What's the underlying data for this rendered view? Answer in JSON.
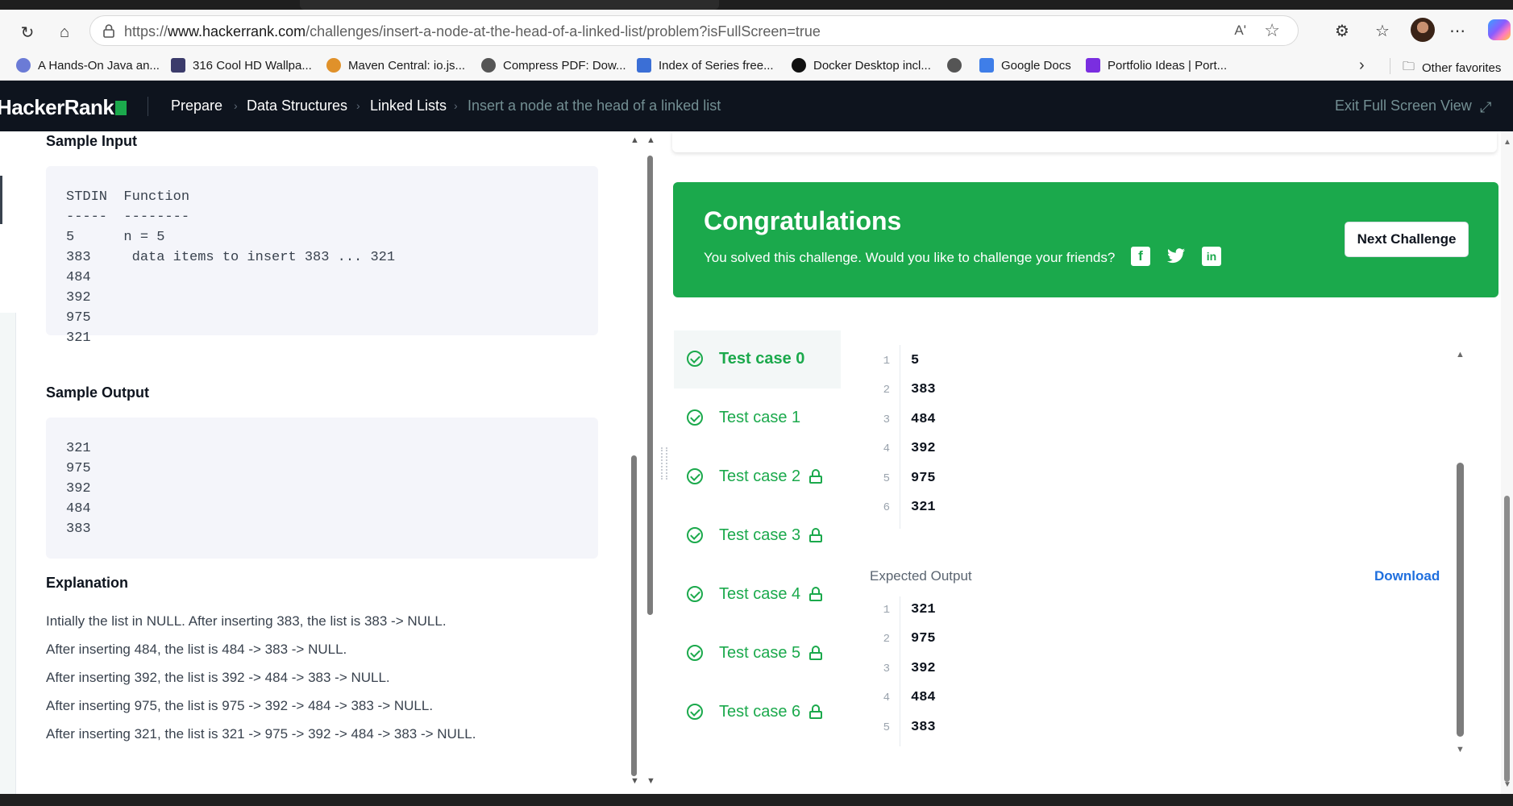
{
  "browser": {
    "url_prefix": "https://",
    "url_domain": "www.hackerrank.com",
    "url_path": "/challenges/insert-a-node-at-the-head-of-a-linked-list/problem?isFullScreen=true",
    "read_aloud_icon": "Aʹ",
    "bookmarks": [
      {
        "label": "A Hands-On Java an...",
        "color": "#6b7bd6"
      },
      {
        "label": "316 Cool HD Wallpa...",
        "color": "#3b3b6b"
      },
      {
        "label": "Maven Central: io.js...",
        "color": "#e0912a"
      },
      {
        "label": "Compress PDF: Dow...",
        "color": "#555555"
      },
      {
        "label": "Index of Series free...",
        "color": "#3b6fd6"
      },
      {
        "label": "Docker Desktop incl...",
        "color": "#111111"
      },
      {
        "label": "",
        "color": "#555555"
      },
      {
        "label": "Google Docs",
        "color": "#3f7ee8"
      },
      {
        "label": "Portfolio Ideas | Port...",
        "color": "#7a2ee0"
      }
    ],
    "other_favorites": "Other favorites"
  },
  "nav": {
    "logo": "HackerRank",
    "crumbs": [
      "Prepare",
      "Data Structures",
      "Linked Lists",
      "Insert a node at the head of a linked list"
    ],
    "exit_full_screen": "Exit Full Screen View"
  },
  "problem": {
    "sample_input_title": "Sample Input",
    "sample_input_lines": [
      "STDIN  Function",
      "-----  --------",
      "5      n = 5",
      "383     data items to insert 383 ... 321",
      "484",
      "392",
      "975",
      "321"
    ],
    "sample_output_title": "Sample Output",
    "sample_output_lines": [
      "321",
      "975",
      "392",
      "484",
      "383"
    ],
    "explanation_title": "Explanation",
    "explanation_lines": [
      "Intially the list in NULL. After inserting 383, the list is 383 -> NULL.",
      "After inserting 484, the list is 484 -> 383 -> NULL.",
      "After inserting 392, the list is 392 -> 484 -> 383 -> NULL.",
      "After inserting 975, the list is 975 -> 392 -> 484 -> 383 -> NULL.",
      "After inserting 321, the list is 321 -> 975 -> 392 -> 484 -> 383 -> NULL."
    ]
  },
  "result": {
    "title": "Congratulations",
    "message": "You solved this challenge. Would you like to challenge your friends?",
    "next_button": "Next Challenge",
    "social": {
      "facebook": "f",
      "twitter": "🐦",
      "linkedin": "in"
    }
  },
  "test_cases": [
    {
      "label": "Test case 0",
      "locked": false,
      "active": true
    },
    {
      "label": "Test case 1",
      "locked": false,
      "active": false
    },
    {
      "label": "Test case 2",
      "locked": true,
      "active": false
    },
    {
      "label": "Test case 3",
      "locked": true,
      "active": false
    },
    {
      "label": "Test case 4",
      "locked": true,
      "active": false
    },
    {
      "label": "Test case 5",
      "locked": true,
      "active": false
    },
    {
      "label": "Test case 6",
      "locked": true,
      "active": false
    }
  ],
  "input_view": {
    "line_numbers": [
      "1",
      "2",
      "3",
      "4",
      "5",
      "6"
    ],
    "lines": [
      "5",
      "383",
      "484",
      "392",
      "975",
      "321"
    ]
  },
  "expected_output": {
    "label": "Expected Output",
    "download": "Download",
    "line_numbers": [
      "1",
      "2",
      "3",
      "4",
      "5"
    ],
    "lines": [
      "321",
      "975",
      "392",
      "484",
      "383"
    ]
  },
  "colors": {
    "brand_green": "#1ba94c",
    "nav_bg": "#0e141e",
    "link_blue": "#1f6fde"
  }
}
